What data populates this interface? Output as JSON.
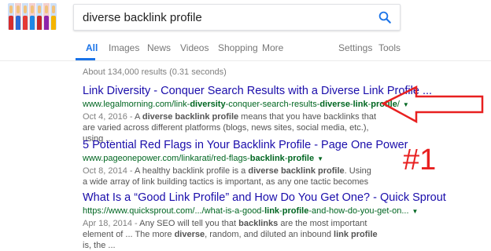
{
  "logo": {
    "figure_colors": [
      "#d62d2d",
      "#2b6bd6",
      "#e53935",
      "#1e88e5",
      "#c62828",
      "#8e24aa",
      "#f4b400"
    ]
  },
  "search": {
    "value": "diverse backlink profile"
  },
  "tabs": [
    {
      "label": "All",
      "active": true
    },
    {
      "label": "Images"
    },
    {
      "label": "News"
    },
    {
      "label": "Videos"
    },
    {
      "label": "Shopping"
    },
    {
      "label": "More"
    },
    {
      "label": "Settings"
    },
    {
      "label": "Tools"
    }
  ],
  "stats": "About 134,000 results (0.31 seconds)",
  "results": [
    {
      "title": "Link Diversity - Conquer Search Results with a Diverse Link Profile ...",
      "url_parts": [
        {
          "t": "www.legalmorning.com/link-",
          "b": false
        },
        {
          "t": "diversity",
          "b": true
        },
        {
          "t": "-conquer-search-results-",
          "b": false
        },
        {
          "t": "diverse",
          "b": true
        },
        {
          "t": "-",
          "b": false
        },
        {
          "t": "link",
          "b": true
        },
        {
          "t": "-",
          "b": false
        },
        {
          "t": "profile",
          "b": true
        },
        {
          "t": "/",
          "b": false
        }
      ],
      "date": "Oct 4, 2016 - ",
      "snippet_parts": [
        {
          "t": "A ",
          "b": false
        },
        {
          "t": "diverse backlink profile",
          "b": true
        },
        {
          "t": " means that you have backlinks that are varied across different platforms (blogs, news sites, social media, etc.), using ...",
          "b": false
        }
      ]
    },
    {
      "title": "5 Potential Red Flags in Your Backlink Profile - Page One Power",
      "url_parts": [
        {
          "t": "www.pageonepower.com/linkarati/red-flags-",
          "b": false
        },
        {
          "t": "backlink",
          "b": true
        },
        {
          "t": "-",
          "b": false
        },
        {
          "t": "profile",
          "b": true
        }
      ],
      "date": "Oct 8, 2014 - ",
      "snippet_parts": [
        {
          "t": "A healthy backlink profile is a ",
          "b": false
        },
        {
          "t": "diverse backlink profile",
          "b": true
        },
        {
          "t": ". Using a wide array of link building tactics is important, as any one tactic becomes ...",
          "b": false
        }
      ]
    },
    {
      "title": "What Is a “Good Link Profile” and How Do You Get One? - Quick Sprout",
      "url_parts": [
        {
          "t": "https://www.quicksprout.com/.../what-is-a-good-",
          "b": false
        },
        {
          "t": "link",
          "b": true
        },
        {
          "t": "-",
          "b": false
        },
        {
          "t": "profile",
          "b": true
        },
        {
          "t": "-and-how-do-you-get-on...",
          "b": false
        }
      ],
      "date": "Apr 18, 2014 - ",
      "snippet_parts": [
        {
          "t": "Any SEO will tell you that ",
          "b": false
        },
        {
          "t": "backlinks",
          "b": true
        },
        {
          "t": " are the most important element of ... The more ",
          "b": false
        },
        {
          "t": "diverse",
          "b": true
        },
        {
          "t": ", random, and diluted an inbound ",
          "b": false
        },
        {
          "t": "link profile",
          "b": true
        },
        {
          "t": " is, the ...",
          "b": false
        }
      ]
    }
  ],
  "annotation": {
    "label": "#1",
    "color": "#e82020"
  },
  "colors": {
    "accent": "#1a73e8",
    "title_link": "#1a0dab",
    "url": "#006621",
    "snippet": "#545454"
  }
}
